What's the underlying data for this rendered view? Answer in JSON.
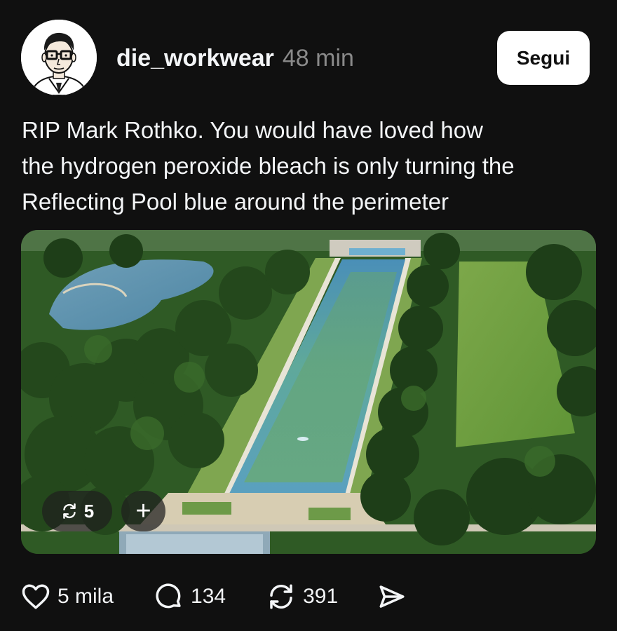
{
  "post": {
    "author": {
      "username": "die_workwear",
      "avatar_icon": "avatar-illustration-man-with-glasses"
    },
    "time_ago": "48 min",
    "follow_label": "Segui",
    "caption_lines": [
      "RIP Mark Rothko. You would have loved how",
      "the hydrogen peroxide bleach is only turning the",
      "Reflecting Pool blue around the perimeter"
    ],
    "media": {
      "description_icon": "aerial-photo-reflecting-pool",
      "repost_count": "5",
      "repost_icon": "repost-icon",
      "add_icon": "plus-icon"
    },
    "actions": {
      "likes": "5 mila",
      "comments": "134",
      "reposts": "391",
      "like_icon": "heart-icon",
      "comment_icon": "comment-icon",
      "repost_icon": "repost-icon",
      "share_icon": "send-icon"
    },
    "colors": {
      "background": "#101010",
      "text": "#f3f5f7",
      "secondary_text": "#8a8a8a",
      "button_bg": "#ffffff"
    }
  }
}
